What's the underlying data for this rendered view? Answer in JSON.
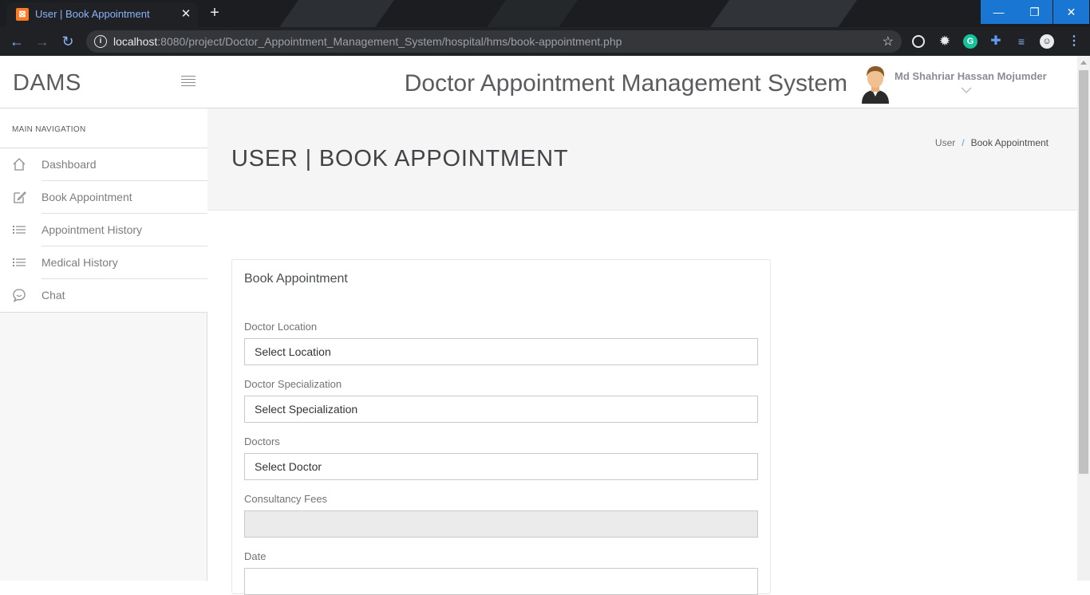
{
  "browser": {
    "tab_title": "User | Book Appointment",
    "tab_favicon": "xampp-icon",
    "url_host": "localhost",
    "url_rest": ":8080/project/Doctor_Appointment_Management_System/hospital/hms/book-appointment.php"
  },
  "sidebar": {
    "brand": "DAMS",
    "nav_heading": "MAIN NAVIGATION",
    "items": [
      {
        "label": "Dashboard",
        "icon": "home-icon"
      },
      {
        "label": "Book Appointment",
        "icon": "edit-icon"
      },
      {
        "label": "Appointment History",
        "icon": "list-icon"
      },
      {
        "label": "Medical History",
        "icon": "list-icon"
      },
      {
        "label": "Chat",
        "icon": "chat-icon"
      }
    ]
  },
  "header": {
    "system_title": "Doctor Appointment Management System",
    "user_name": "Md Shahriar Hassan Mojumder"
  },
  "page": {
    "title": "USER | BOOK APPOINTMENT",
    "breadcrumb": [
      "User",
      "Book Appointment"
    ]
  },
  "form": {
    "panel_title": "Book Appointment",
    "fields": [
      {
        "label": "Doctor Location",
        "value": "Select Location"
      },
      {
        "label": "Doctor Specialization",
        "value": "Select Specialization"
      },
      {
        "label": "Doctors",
        "value": "Select Doctor"
      },
      {
        "label": "Consultancy Fees",
        "value": ""
      },
      {
        "label": "Date",
        "value": ""
      }
    ]
  },
  "colors": {
    "accent": "#1976d2",
    "breadcrumb_separator": "#5b9bd5"
  }
}
